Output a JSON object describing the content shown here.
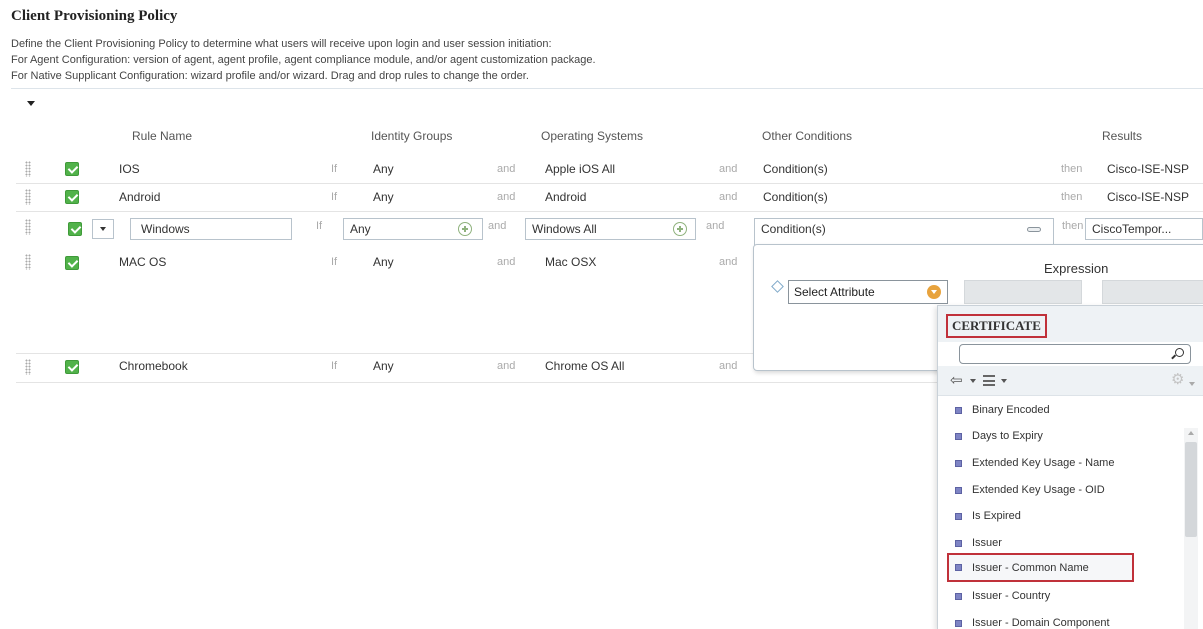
{
  "page": {
    "title": "Client Provisioning Policy",
    "description": [
      "Define the Client Provisioning Policy to determine what users will receive upon login and user session initiation:",
      "For Agent Configuration: version of agent, agent profile, agent compliance module, and/or agent customization package.",
      "For Native Supplicant Configuration: wizard profile and/or wizard. Drag and drop rules to change the order."
    ]
  },
  "table": {
    "headers": {
      "rule_name": "Rule Name",
      "identity_groups": "Identity Groups",
      "operating_systems": "Operating Systems",
      "other_conditions": "Other Conditions",
      "results": "Results"
    },
    "keywords": {
      "if": "If",
      "and": "and",
      "then": "then"
    },
    "rows": [
      {
        "name": "IOS",
        "identity": "Any",
        "os": "Apple iOS All",
        "conditions": "Condition(s)",
        "result": "Cisco-ISE-NSP",
        "enabled": true
      },
      {
        "name": "Android",
        "identity": "Any",
        "os": "Android",
        "conditions": "Condition(s)",
        "result": "Cisco-ISE-NSP",
        "enabled": true
      },
      {
        "name": "Windows",
        "identity": "Any",
        "os": "Windows All",
        "conditions": "Condition(s)",
        "result": "CiscoTempor...",
        "enabled": true,
        "editing": true
      },
      {
        "name": "MAC OS",
        "identity": "Any",
        "os": "Mac OSX",
        "enabled": true
      },
      {
        "name": "Chromebook",
        "identity": "Any",
        "os": "Chrome OS All",
        "enabled": true
      }
    ]
  },
  "condition_panel": {
    "expression_label": "Expression",
    "select_attribute": "Select Attribute"
  },
  "attribute_picker": {
    "dictionary": "CERTIFICATE",
    "search_value": "",
    "items": [
      "Binary Encoded",
      "Days to Expiry",
      "Extended Key Usage - Name",
      "Extended Key Usage - OID",
      "Is Expired",
      "Issuer",
      "Issuer - Common Name",
      "Issuer - Country",
      "Issuer - Domain Component"
    ],
    "highlighted_item": "Issuer - Common Name"
  },
  "icons": {
    "collapse": "caret-down-icon",
    "drag": "drag-handle-icon",
    "checkbox": "checkbox-checked-icon",
    "add": "add-circle-icon",
    "collapse_panel": "collapse-icon",
    "attr_dropdown": "dropdown-circle-icon",
    "search": "search-icon",
    "back": "back-arrow-icon",
    "list_view": "list-view-icon",
    "settings": "gear-icon",
    "attribute": "attribute-icon"
  },
  "colors": {
    "checkbox_green": "#51b24a",
    "highlight_red": "#c0313a",
    "dropdown_orange": "#e8a33d",
    "attribute_purple": "#7e84c4"
  }
}
